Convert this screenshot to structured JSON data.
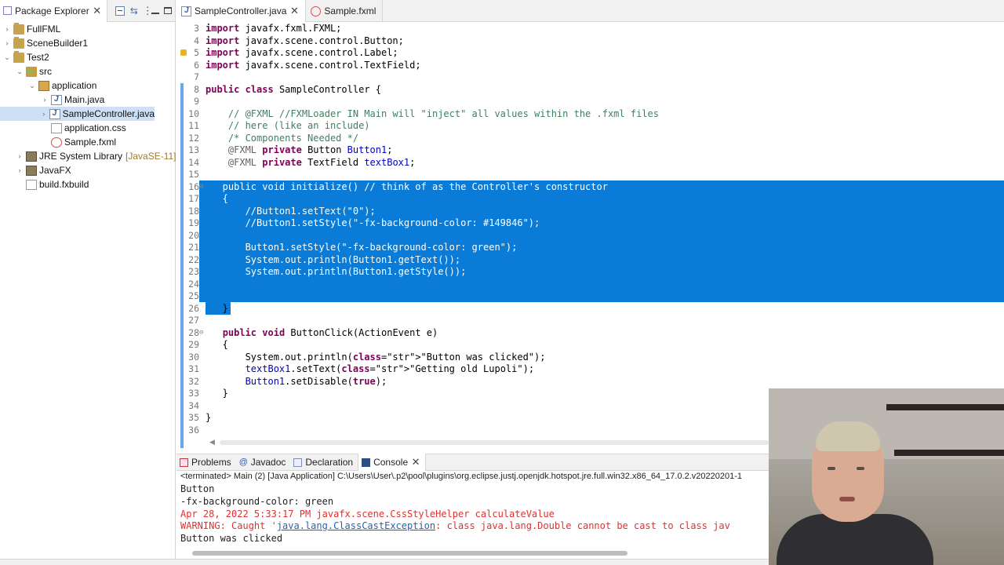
{
  "package_explorer": {
    "tab_label": "Package Explorer",
    "tree": [
      {
        "label": "FullFML",
        "icon": "project-icon",
        "indent": 0,
        "arrow": "›"
      },
      {
        "label": "SceneBuilder1",
        "icon": "project-icon",
        "indent": 0,
        "arrow": "›"
      },
      {
        "label": "Test2",
        "icon": "project-icon",
        "indent": 0,
        "arrow": "⌄"
      },
      {
        "label": "src",
        "icon": "source-folder-icon",
        "indent": 1,
        "arrow": "⌄"
      },
      {
        "label": "application",
        "icon": "package-icon",
        "indent": 2,
        "arrow": "⌄"
      },
      {
        "label": "Main.java",
        "icon": "java-file-icon",
        "indent": 3,
        "arrow": "›"
      },
      {
        "label": "SampleController.java",
        "icon": "java-file-icon",
        "indent": 3,
        "arrow": "›",
        "selected": true
      },
      {
        "label": "application.css",
        "icon": "css-file-icon",
        "indent": 3,
        "arrow": ""
      },
      {
        "label": "Sample.fxml",
        "icon": "fxml-file-icon",
        "indent": 3,
        "arrow": ""
      },
      {
        "label": "JRE System Library",
        "suffix": "[JavaSE-11]",
        "icon": "library-icon",
        "indent": 1,
        "arrow": "›"
      },
      {
        "label": "JavaFX",
        "icon": "library-icon",
        "indent": 1,
        "arrow": "›"
      },
      {
        "label": "build.fxbuild",
        "icon": "file-icon",
        "indent": 1,
        "arrow": ""
      }
    ]
  },
  "editor": {
    "tabs": [
      {
        "label": "SampleController.java",
        "icon": "java-file-icon",
        "active": true,
        "closable": true
      },
      {
        "label": "Sample.fxml",
        "icon": "fxml-file-icon",
        "active": false,
        "closable": false
      }
    ],
    "lines": [
      {
        "n": "3",
        "text": "import javafx.fxml.FXML;"
      },
      {
        "n": "4",
        "text": "import javafx.scene.control.Button;"
      },
      {
        "n": "5",
        "text": "import javafx.scene.control.Label;"
      },
      {
        "n": "6",
        "text": "import javafx.scene.control.TextField;"
      },
      {
        "n": "7",
        "text": ""
      },
      {
        "n": "8",
        "text": "public class SampleController {"
      },
      {
        "n": "9",
        "text": ""
      },
      {
        "n": "10",
        "text": "    // @FXML //FXMLoader IN Main will \"inject\" all values within the .fxml files"
      },
      {
        "n": "11",
        "text": "    // here (like an include)"
      },
      {
        "n": "12",
        "text": "    /* Components Needed */"
      },
      {
        "n": "13",
        "text": "    @FXML private Button Button1;"
      },
      {
        "n": "14",
        "text": "    @FXML private TextField textBox1;"
      },
      {
        "n": "15",
        "text": ""
      },
      {
        "n": "16",
        "text": "   public void initialize() // think of as the Controller's constructor"
      },
      {
        "n": "17",
        "text": "   {"
      },
      {
        "n": "18",
        "text": "       //Button1.setText(\"0\");"
      },
      {
        "n": "19",
        "text": "       //Button1.setStyle(\"-fx-background-color: #149846\");"
      },
      {
        "n": "20",
        "text": ""
      },
      {
        "n": "21",
        "text": "       Button1.setStyle(\"-fx-background-color: green\");"
      },
      {
        "n": "22",
        "text": "       System.out.println(Button1.getText());"
      },
      {
        "n": "23",
        "text": "       System.out.println(Button1.getStyle());"
      },
      {
        "n": "24",
        "text": ""
      },
      {
        "n": "25",
        "text": ""
      },
      {
        "n": "26",
        "text": "   }"
      },
      {
        "n": "27",
        "text": ""
      },
      {
        "n": "28",
        "text": "   public void ButtonClick(ActionEvent e)"
      },
      {
        "n": "29",
        "text": "   {"
      },
      {
        "n": "30",
        "text": "       System.out.println(\"Button was clicked\");"
      },
      {
        "n": "31",
        "text": "       textBox1.setText(\"Getting old Lupoli\");"
      },
      {
        "n": "32",
        "text": "       Button1.setDisable(true);"
      },
      {
        "n": "33",
        "text": "   }"
      },
      {
        "n": "34",
        "text": ""
      },
      {
        "n": "35",
        "text": "}"
      },
      {
        "n": "36",
        "text": ""
      }
    ]
  },
  "console": {
    "tabs": [
      {
        "label": "Problems",
        "icon": "problems-icon",
        "active": false
      },
      {
        "label": "Javadoc",
        "icon": "javadoc-icon",
        "active": false
      },
      {
        "label": "Declaration",
        "icon": "declaration-icon",
        "active": false
      },
      {
        "label": "Console",
        "icon": "console-icon",
        "active": true
      }
    ],
    "status": "<terminated> Main (2) [Java Application] C:\\Users\\User\\.p2\\pool\\plugins\\org.eclipse.justj.openjdk.hotspot.jre.full.win32.x86_64_17.0.2.v20220201-1",
    "output": [
      {
        "text": "Button",
        "kind": "normal"
      },
      {
        "text": "-fx-background-color: green",
        "kind": "normal"
      },
      {
        "text": "Apr 28, 2022 5:33:17 PM javafx.scene.CssStyleHelper calculateValue",
        "kind": "err"
      },
      {
        "prefix": "WARNING: Caught '",
        "link": "java.lang.ClassCastException",
        "suffix": ": class java.lang.Double cannot be cast to class jav",
        "kind": "err"
      },
      {
        "text": "Button was clicked",
        "kind": "normal"
      }
    ]
  },
  "colors": {
    "selection": "#0a7bd6",
    "keyword": "#7f0055",
    "comment": "#3f7f5f",
    "string": "#2a00ff",
    "error": "#e03030"
  }
}
